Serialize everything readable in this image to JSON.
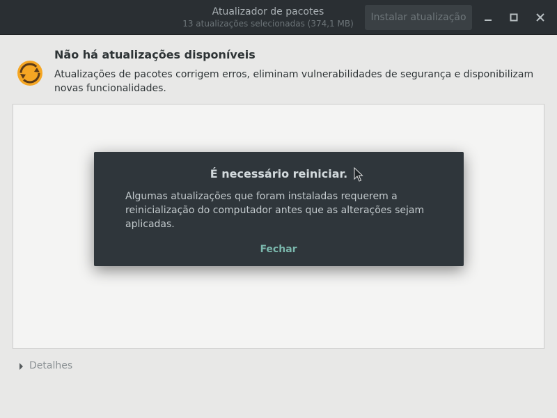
{
  "window": {
    "title": "Atualizador de pacotes",
    "subtitle": "13 atualizações selecionadas (374,1 MB)",
    "install_label": "Instalar atualização",
    "controls": {
      "minimize_icon": "minimize-icon",
      "maximize_icon": "maximize-icon",
      "close_icon": "close-icon"
    }
  },
  "main": {
    "app_icon": "software-update-icon",
    "heading": "Não há atualizações disponíveis",
    "description": "Atualizações de pacotes corrigem erros, eliminam vulnerabilidades de segurança e disponibilizam novas funcionalidades.",
    "details_label": "Detalhes"
  },
  "dialog": {
    "title": "É necessário reiniciar.",
    "message": "Algumas atualizações que foram instaladas requerem a reinicialização do computador antes que as alterações sejam aplicadas.",
    "close_label": "Fechar"
  },
  "colors": {
    "headerbar": "#2a2f33",
    "dialog_bg": "#2f363b",
    "accent": "#7bb8ad",
    "window_bg": "#e8e8e7",
    "icon_orange": "#f5a623"
  }
}
